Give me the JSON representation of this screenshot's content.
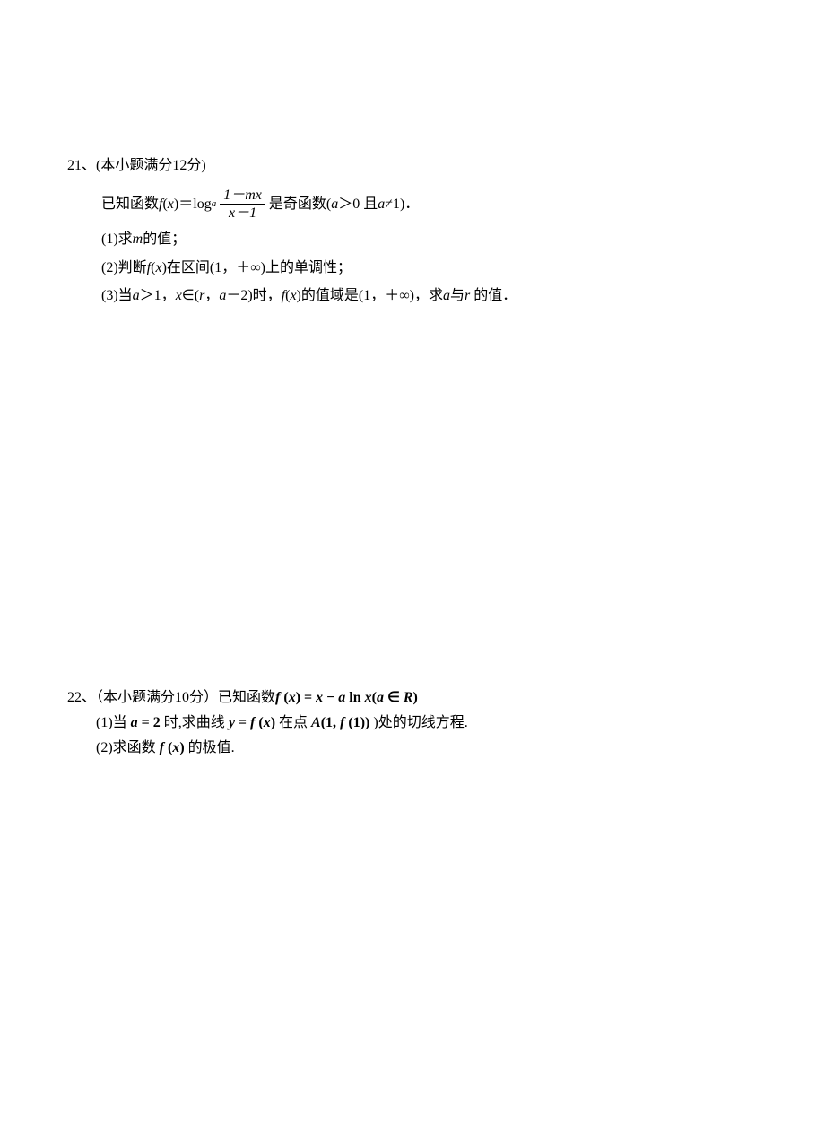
{
  "problems": [
    {
      "number": "21、(本小题满分12分)",
      "stem": {
        "prefix": "已知函数 ",
        "fx": "f(x)＝",
        "log_label": "log",
        "log_sub": "a",
        "frac_num": "1－mx",
        "frac_den": "x－1",
        "suffix": "是奇函数(",
        "cond": "a",
        "cond_text1": "＞0 且 ",
        "cond2": "a",
        "cond_text2": "≠1)．"
      },
      "parts": [
        {
          "label": "(1)",
          "text": "求",
          "var1": "m",
          "text2": "的值；"
        },
        {
          "label": "(2)",
          "text": "判断",
          "var1": "f",
          "paren": "(",
          "var2": "x",
          "paren2": ")",
          "text2": "在区间(1，＋∞)上的单调性；"
        },
        {
          "label": "(3)",
          "text": "当",
          "var1": "a",
          "text2": "＞1，",
          "var2": "x",
          "text3": "∈(",
          "var3": "r",
          "text4": "，",
          "var4": "a",
          "text5": "－2)时，",
          "var5": "f",
          "paren": "(",
          "var6": "x",
          "paren2": ")",
          "text6": "的值域是(1，＋∞)，求",
          "var7": "a",
          "text7": "与",
          "var8": "r",
          "text8": " 的值．"
        }
      ]
    },
    {
      "number": "22、（本小题满分10分）",
      "stem_prefix": "已知函数 ",
      "stem_math": "f (x) = x − a ln x(a ∈ R)",
      "parts": [
        {
          "label": "(1)",
          "text1": "当 ",
          "math1": "a = 2",
          "text2": " 时,求曲线 ",
          "math2": "y = f (x)",
          "text3": " 在点 ",
          "math3": "A(1, f (1))",
          "text4": " )处的切线方程."
        },
        {
          "label": "(2)",
          "text1": "求函数 ",
          "math1": "f (x)",
          "text2": " 的极值."
        }
      ]
    }
  ]
}
